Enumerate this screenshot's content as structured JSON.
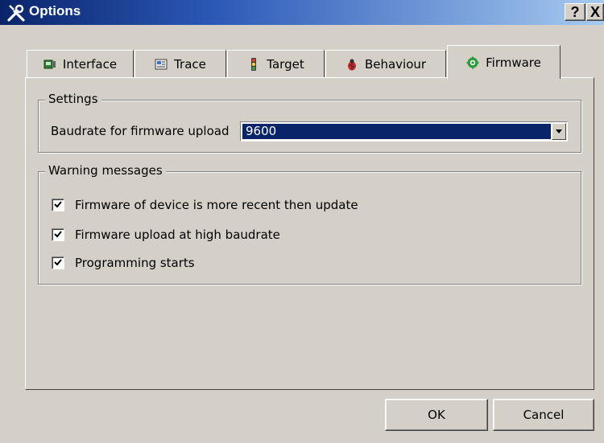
{
  "window": {
    "title": "Options",
    "help_label": "?",
    "close_label": "X"
  },
  "tabs": [
    {
      "label": "Interface",
      "icon": "interface-icon"
    },
    {
      "label": "Trace",
      "icon": "trace-icon"
    },
    {
      "label": "Target",
      "icon": "traffic-light-icon"
    },
    {
      "label": "Behaviour",
      "icon": "ladybug-icon"
    },
    {
      "label": "Firmware",
      "icon": "gear-icon",
      "active": true
    }
  ],
  "settings": {
    "title": "Settings",
    "baudrate_label": "Baudrate for firmware upload",
    "baudrate_value": "9600"
  },
  "warnings": {
    "title": "Warning messages",
    "items": [
      {
        "label": "Firmware of device is more recent then update",
        "checked": true
      },
      {
        "label": "Firmware upload at high baudrate",
        "checked": true
      },
      {
        "label": "Programming starts",
        "checked": true
      }
    ]
  },
  "buttons": {
    "ok_label": "OK",
    "cancel_label": "Cancel"
  },
  "colors": {
    "selection": "#0a246a",
    "face": "#d4d0c8",
    "titlebar_start": "#0a246a",
    "titlebar_end": "#a6caf0"
  }
}
